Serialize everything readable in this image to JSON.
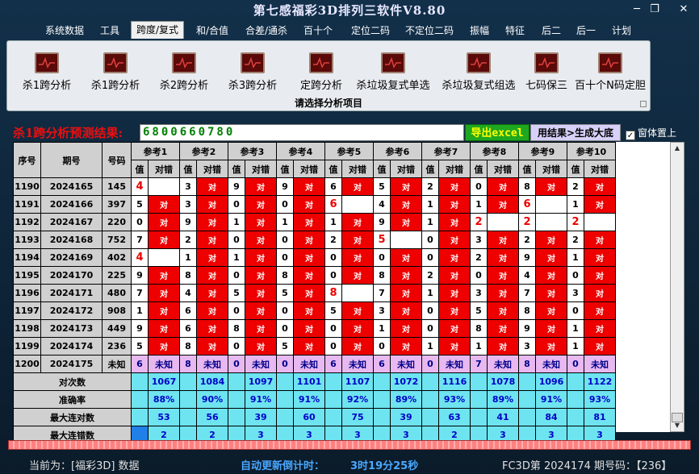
{
  "window": {
    "title": "第七感福彩3D排列三软件V8.80",
    "min": "─",
    "max": "❐",
    "close": "✕"
  },
  "menu": [
    "系统数据",
    "工具",
    "跨度/复式",
    "和/合值",
    "合差/通杀",
    "百十个",
    "定位二码",
    "不定位二码",
    "振幅",
    "特征",
    "后二",
    "后一",
    "计划"
  ],
  "active_menu": "跨度/复式",
  "tools": [
    "杀1跨分析",
    "杀1跨分析",
    "杀2跨分析",
    "杀3跨分析",
    "定跨分析",
    "杀垃圾复式单选",
    "杀垃圾复式组选",
    "七码保三",
    "百十个N码定胆"
  ],
  "panel_caption": "请选择分析项目",
  "result": {
    "label": "杀1跨分析预测结果:",
    "value": "6800660780",
    "export_label": "导出excel",
    "generate_label": "用结果>生成大底",
    "topmost_label": "窗体置上",
    "topmost_checked": "✓"
  },
  "table": {
    "col_seq": "序号",
    "col_period": "期号",
    "col_number": "号码",
    "refs": [
      "参考1",
      "参考2",
      "参考3",
      "参考4",
      "参考5",
      "参考6",
      "参考7",
      "参考8",
      "参考9",
      "参考10"
    ],
    "sub_val": "值",
    "sub_ok": "对错",
    "rows": [
      {
        "seq": "1190",
        "period": "2024165",
        "num": "145",
        "cells": [
          [
            "4",
            "",
            "x"
          ],
          [
            "3",
            "对",
            ""
          ],
          [
            "9",
            "对",
            ""
          ],
          [
            "9",
            "对",
            ""
          ],
          [
            "6",
            "对",
            ""
          ],
          [
            "5",
            "对",
            ""
          ],
          [
            "2",
            "对",
            ""
          ],
          [
            "0",
            "对",
            ""
          ],
          [
            "8",
            "对",
            ""
          ],
          [
            "2",
            "对",
            ""
          ]
        ]
      },
      {
        "seq": "1191",
        "period": "2024166",
        "num": "397",
        "cells": [
          [
            "5",
            "对",
            ""
          ],
          [
            "3",
            "对",
            ""
          ],
          [
            "0",
            "对",
            ""
          ],
          [
            "0",
            "对",
            ""
          ],
          [
            "6",
            "",
            "x"
          ],
          [
            "4",
            "对",
            ""
          ],
          [
            "1",
            "对",
            ""
          ],
          [
            "1",
            "对",
            ""
          ],
          [
            "6",
            "",
            "x"
          ],
          [
            "1",
            "对",
            ""
          ]
        ]
      },
      {
        "seq": "1192",
        "period": "2024167",
        "num": "220",
        "cells": [
          [
            "0",
            "对",
            ""
          ],
          [
            "9",
            "对",
            ""
          ],
          [
            "1",
            "对",
            ""
          ],
          [
            "1",
            "对",
            ""
          ],
          [
            "1",
            "对",
            ""
          ],
          [
            "9",
            "对",
            ""
          ],
          [
            "1",
            "对",
            ""
          ],
          [
            "2",
            "",
            "x"
          ],
          [
            "2",
            "",
            "x"
          ],
          [
            "2",
            "",
            "x"
          ]
        ]
      },
      {
        "seq": "1193",
        "period": "2024168",
        "num": "752",
        "cells": [
          [
            "7",
            "对",
            ""
          ],
          [
            "2",
            "对",
            ""
          ],
          [
            "0",
            "对",
            ""
          ],
          [
            "0",
            "对",
            ""
          ],
          [
            "2",
            "对",
            ""
          ],
          [
            "5",
            "",
            "x"
          ],
          [
            "0",
            "对",
            ""
          ],
          [
            "3",
            "对",
            ""
          ],
          [
            "2",
            "对",
            ""
          ],
          [
            "2",
            "对",
            ""
          ]
        ]
      },
      {
        "seq": "1194",
        "period": "2024169",
        "num": "402",
        "cells": [
          [
            "4",
            "",
            "x"
          ],
          [
            "1",
            "对",
            ""
          ],
          [
            "1",
            "对",
            ""
          ],
          [
            "0",
            "对",
            ""
          ],
          [
            "0",
            "对",
            ""
          ],
          [
            "0",
            "对",
            ""
          ],
          [
            "0",
            "对",
            ""
          ],
          [
            "2",
            "对",
            ""
          ],
          [
            "9",
            "对",
            ""
          ],
          [
            "1",
            "对",
            ""
          ]
        ]
      },
      {
        "seq": "1195",
        "period": "2024170",
        "num": "225",
        "cells": [
          [
            "9",
            "对",
            ""
          ],
          [
            "8",
            "对",
            ""
          ],
          [
            "0",
            "对",
            ""
          ],
          [
            "8",
            "对",
            ""
          ],
          [
            "0",
            "对",
            ""
          ],
          [
            "8",
            "对",
            ""
          ],
          [
            "2",
            "对",
            ""
          ],
          [
            "0",
            "对",
            ""
          ],
          [
            "4",
            "对",
            ""
          ],
          [
            "0",
            "对",
            ""
          ]
        ]
      },
      {
        "seq": "1196",
        "period": "2024171",
        "num": "480",
        "cells": [
          [
            "7",
            "对",
            ""
          ],
          [
            "4",
            "对",
            ""
          ],
          [
            "5",
            "对",
            ""
          ],
          [
            "5",
            "对",
            ""
          ],
          [
            "8",
            "",
            "x"
          ],
          [
            "7",
            "对",
            ""
          ],
          [
            "1",
            "对",
            ""
          ],
          [
            "3",
            "对",
            ""
          ],
          [
            "7",
            "对",
            ""
          ],
          [
            "3",
            "对",
            ""
          ]
        ]
      },
      {
        "seq": "1197",
        "period": "2024172",
        "num": "908",
        "cells": [
          [
            "1",
            "对",
            ""
          ],
          [
            "6",
            "对",
            ""
          ],
          [
            "0",
            "对",
            ""
          ],
          [
            "0",
            "对",
            ""
          ],
          [
            "5",
            "对",
            ""
          ],
          [
            "3",
            "对",
            ""
          ],
          [
            "0",
            "对",
            ""
          ],
          [
            "5",
            "对",
            ""
          ],
          [
            "8",
            "对",
            ""
          ],
          [
            "0",
            "对",
            ""
          ]
        ]
      },
      {
        "seq": "1198",
        "period": "2024173",
        "num": "449",
        "cells": [
          [
            "9",
            "对",
            ""
          ],
          [
            "6",
            "对",
            ""
          ],
          [
            "8",
            "对",
            ""
          ],
          [
            "0",
            "对",
            ""
          ],
          [
            "0",
            "对",
            ""
          ],
          [
            "1",
            "对",
            ""
          ],
          [
            "0",
            "对",
            ""
          ],
          [
            "8",
            "对",
            ""
          ],
          [
            "9",
            "对",
            ""
          ],
          [
            "1",
            "对",
            ""
          ]
        ]
      },
      {
        "seq": "1199",
        "period": "2024174",
        "num": "236",
        "cells": [
          [
            "5",
            "对",
            ""
          ],
          [
            "8",
            "对",
            ""
          ],
          [
            "0",
            "对",
            ""
          ],
          [
            "5",
            "对",
            ""
          ],
          [
            "0",
            "对",
            ""
          ],
          [
            "0",
            "对",
            ""
          ],
          [
            "1",
            "对",
            ""
          ],
          [
            "1",
            "对",
            ""
          ],
          [
            "3",
            "对",
            ""
          ],
          [
            "1",
            "对",
            ""
          ]
        ]
      }
    ],
    "pending": {
      "seq": "1200",
      "period": "2024175",
      "num": "未知",
      "vals": [
        "6",
        "8",
        "0",
        "0",
        "6",
        "6",
        "0",
        "7",
        "8",
        "0"
      ],
      "unknown": "未知"
    },
    "stat_labels": [
      "对次数",
      "准确率",
      "最大连对数",
      "最大连错数"
    ],
    "stats": [
      [
        "1067",
        "1084",
        "1097",
        "1101",
        "1107",
        "1072",
        "1116",
        "1078",
        "1096",
        "1122"
      ],
      [
        "88%",
        "90%",
        "91%",
        "91%",
        "92%",
        "89%",
        "93%",
        "89%",
        "91%",
        "93%"
      ],
      [
        "53",
        "56",
        "39",
        "60",
        "75",
        "39",
        "63",
        "41",
        "84",
        "81"
      ],
      [
        "2",
        "2",
        "3",
        "3",
        "3",
        "3",
        "2",
        "3",
        "3",
        "3"
      ]
    ]
  },
  "status": {
    "current": "当前为：[福彩3D] 数据",
    "countdown_label": "自动更新倒计时：",
    "countdown": "3时19分25秒",
    "period": "FC3D第 2024174 期号码：【236】"
  }
}
